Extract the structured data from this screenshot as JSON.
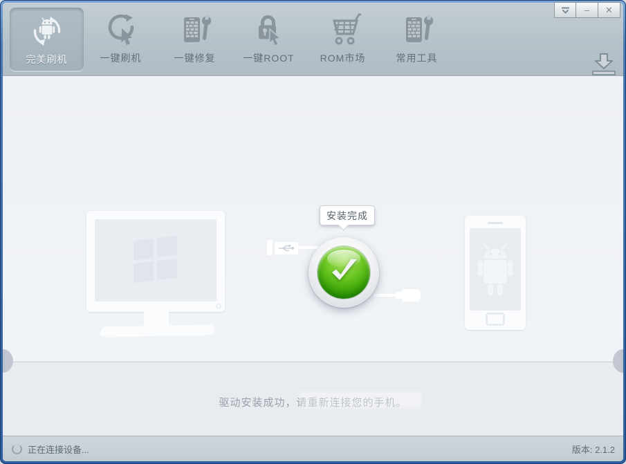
{
  "app": {
    "title": "完美刷机"
  },
  "toolbar": {
    "tabs": [
      {
        "label": "完美刷机",
        "active": true
      },
      {
        "label": "一键刷机",
        "active": false
      },
      {
        "label": "一键修复",
        "active": false
      },
      {
        "label": "一键ROOT",
        "active": false
      },
      {
        "label": "ROM市场",
        "active": false
      },
      {
        "label": "常用工具",
        "active": false
      }
    ]
  },
  "window_controls": {
    "minimize_glyph": "–",
    "close_glyph": "✕"
  },
  "main": {
    "tooltip": "安装完成",
    "message": "驱动安装成功，请重新连接您的手机。"
  },
  "statusbar": {
    "status": "正在连接设备...",
    "version": "版本: 2.1.2"
  },
  "colors": {
    "frame_blue": "#2e5f9e",
    "toolbar_bg": "#b6c2c9",
    "active_tab_bg": "#a3b1bb",
    "main_bg": "#eef1f5",
    "lower_bg": "#e8ebef",
    "statusbar_bg": "#c8d0d6",
    "success_green": "#35a006",
    "icon_gray": "#8a949d",
    "label_gray": "#626e79"
  }
}
